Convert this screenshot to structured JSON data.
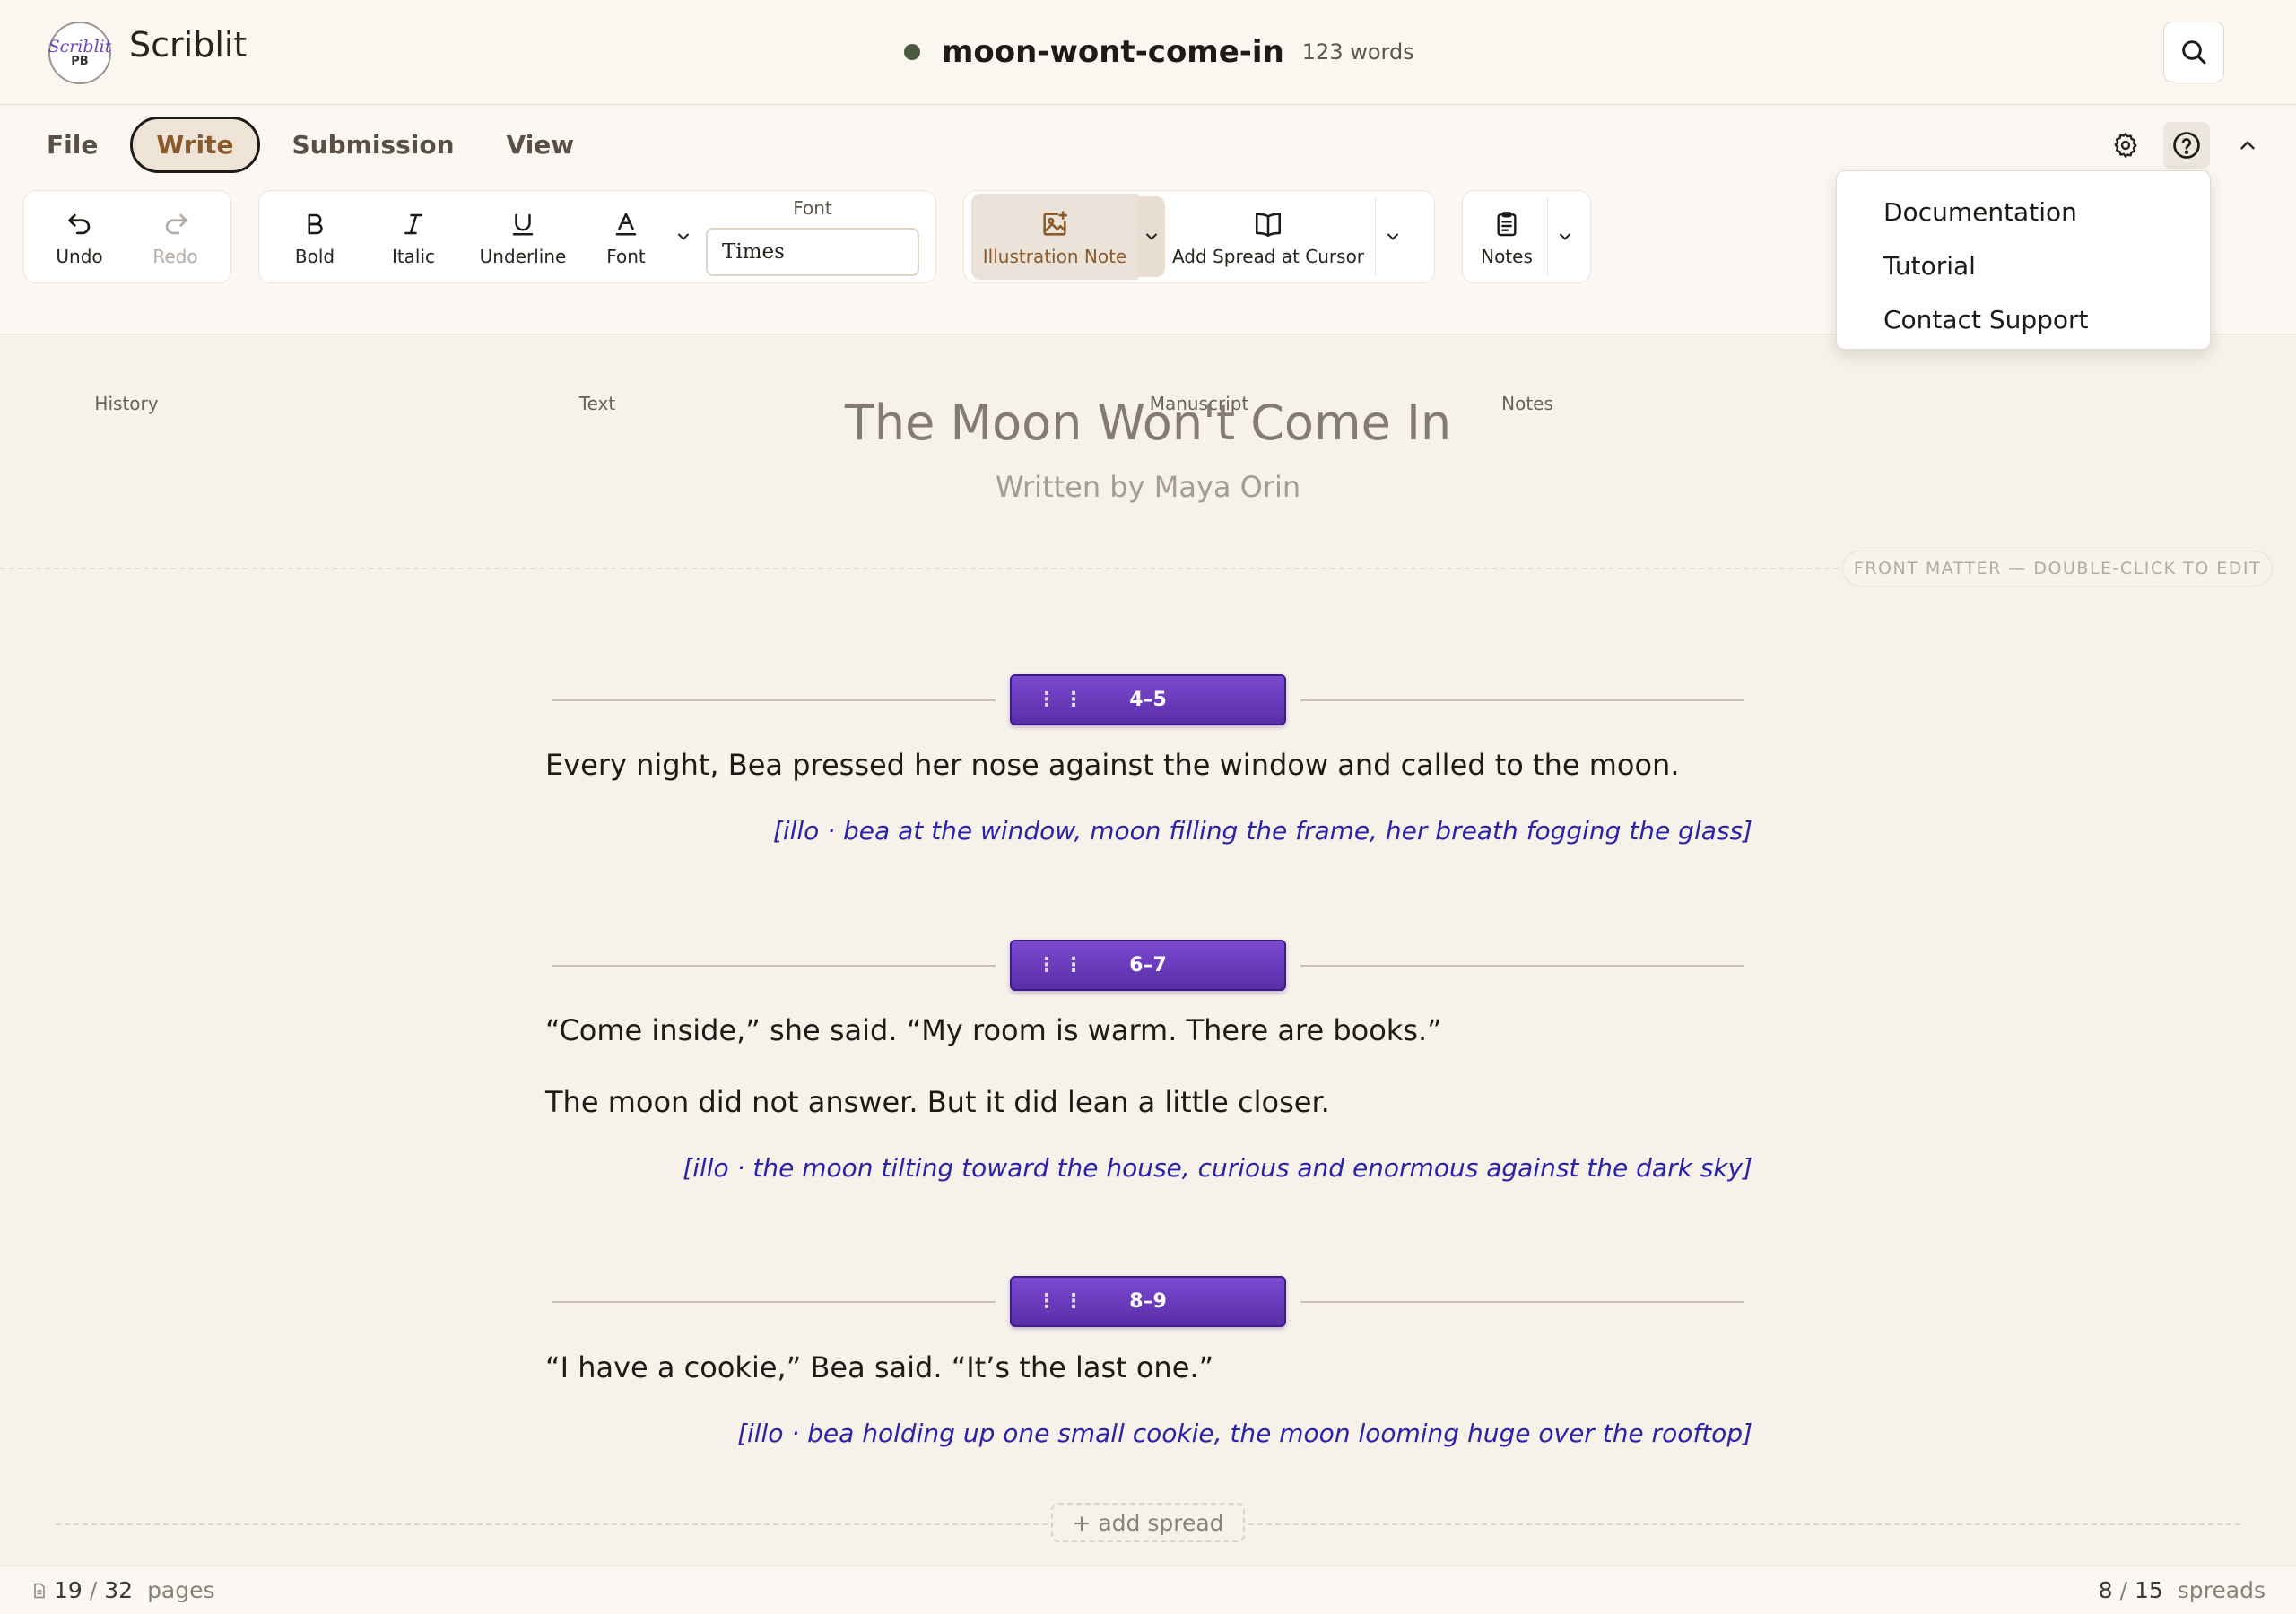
{
  "app": {
    "name": "Scriblit",
    "logo_top": "Scriblit",
    "logo_bottom": "PB"
  },
  "document": {
    "filename": "moon-wont-come-in",
    "word_count": "123 words",
    "status_color": "#4a5a3e"
  },
  "tabs": [
    {
      "label": "File",
      "active": false
    },
    {
      "label": "Write",
      "active": true
    },
    {
      "label": "Submission",
      "active": false
    },
    {
      "label": "View",
      "active": false
    }
  ],
  "ribbon": {
    "history": {
      "label": "History",
      "undo": "Undo",
      "redo": "Redo"
    },
    "text": {
      "label": "Text",
      "bold": "Bold",
      "italic": "Italic",
      "underline": "Underline",
      "font": "Font",
      "font_field_label": "Font",
      "font_value": "Times"
    },
    "manuscript": {
      "label": "Manuscript",
      "illustration_note": "Illustration Note",
      "add_spread": "Add Spread at Cursor"
    },
    "notes": {
      "label": "Notes",
      "notes": "Notes"
    }
  },
  "help_menu": {
    "items": [
      "Documentation",
      "Tutorial",
      "Contact Support"
    ]
  },
  "front_matter": {
    "title": "The Moon Won't Come In",
    "author": "Written by Maya Orin",
    "badge": "FRONT MATTER — DOUBLE-CLICK TO EDIT"
  },
  "spreads": [
    {
      "pages": "4–5",
      "grip": "⋮⋮",
      "paragraphs": [
        "Every night, Bea pressed her nose against the window and called to the moon."
      ],
      "illo": "[illo · bea at the window, moon filling the frame, her breath fogging the glass]"
    },
    {
      "pages": "6–7",
      "grip": "⋮⋮",
      "paragraphs": [
        "“Come inside,” she said. “My room is warm. There are books.”",
        "The moon did not answer. But it did lean a little closer."
      ],
      "illo": "[illo · the moon tilting toward the house, curious and enormous against the dark sky]"
    },
    {
      "pages": "8–9",
      "grip": "⋮⋮",
      "paragraphs": [
        "“I have a cookie,” Bea said. “It’s the last one.”"
      ],
      "illo": "[illo · bea holding up one small cookie, the moon looming huge over the rooftop]"
    }
  ],
  "add_spread": "+ add spread",
  "status": {
    "pages_current": "19",
    "pages_sep": "/",
    "pages_total": "32",
    "pages_label": "pages",
    "spreads_current": "8",
    "spreads_sep": "/",
    "spreads_total": "15",
    "spreads_label": "spreads"
  },
  "colors": {
    "accent": "#6a3cc0",
    "illo_text": "#2b22aa",
    "background": "#f6f2ea"
  }
}
